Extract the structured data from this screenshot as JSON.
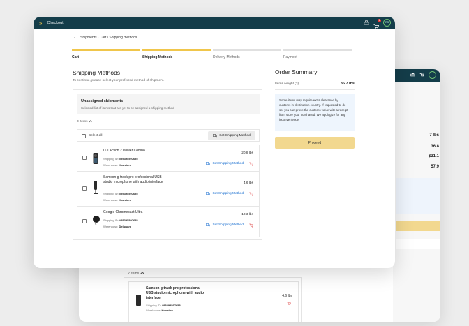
{
  "app": {
    "title": "Checkout",
    "cart_badge": "1",
    "avatar_initials": "RS"
  },
  "breadcrumb": "Shipments \\ Cart \\ Shipping methods",
  "steps": [
    {
      "label": "Cart",
      "active": true
    },
    {
      "label": "Shipping Methods",
      "active": true
    },
    {
      "label": "Delivery Methods",
      "active": false
    },
    {
      "label": "Payment",
      "active": false
    }
  ],
  "page": {
    "title": "Shipping Methods",
    "subtitle": "To continue, please select your preferred method of shipment."
  },
  "unassigned": {
    "title": "Unassigned shipments",
    "subtitle": "Selected list of items that are yet to be assigned a shipping method"
  },
  "items_count": "3 items",
  "select_all": "Select all",
  "set_shipping_button": "Set Shipping Method",
  "shipping_id_label": "Shipping ID:",
  "warehouse_label": "Warehouse:",
  "products": [
    {
      "title": "DJI Action 2 Power Combo",
      "shipping_id": "#95395597655",
      "warehouse": "Houston",
      "weight": "20.8 lbs",
      "action": "Set Shipping Method"
    },
    {
      "title": "Samson g-track pro professional USB studio microphone with audio interface",
      "shipping_id": "#95395597655",
      "warehouse": "Houston",
      "weight": "4.6 lbs",
      "action": "Set Shipping Method"
    },
    {
      "title": "Google Chromecast Ultra",
      "shipping_id": "#95395597655",
      "warehouse": "Delaware",
      "weight": "10.3 lbs",
      "action": "Set Shipping Method"
    }
  ],
  "summary": {
    "title": "Order Summary",
    "weight_label": "Items weight (3)",
    "weight_value": "35.7 lbs",
    "info": "Some items may require extra clearance by customs in destination country. If requested to do so, you can prove the customs value with a receipt from store your purchased. We apologize for any inconvenience.",
    "proceed": "Proceed"
  },
  "background_card": {
    "values": [
      ".7 lbs",
      "36.8",
      "$31.1",
      "57.9"
    ],
    "items_count": "2 items",
    "product": {
      "title": "Samson g-track pro professional USB studio microphone with audio interface",
      "shipping_id": "#95395597655",
      "warehouse": "Houston",
      "weight": "4.6 lbs"
    }
  },
  "colors": {
    "topbar": "#143d4a",
    "accent": "#f0c64b",
    "link": "#1a6fd0",
    "info_bg": "#eef5fd"
  }
}
